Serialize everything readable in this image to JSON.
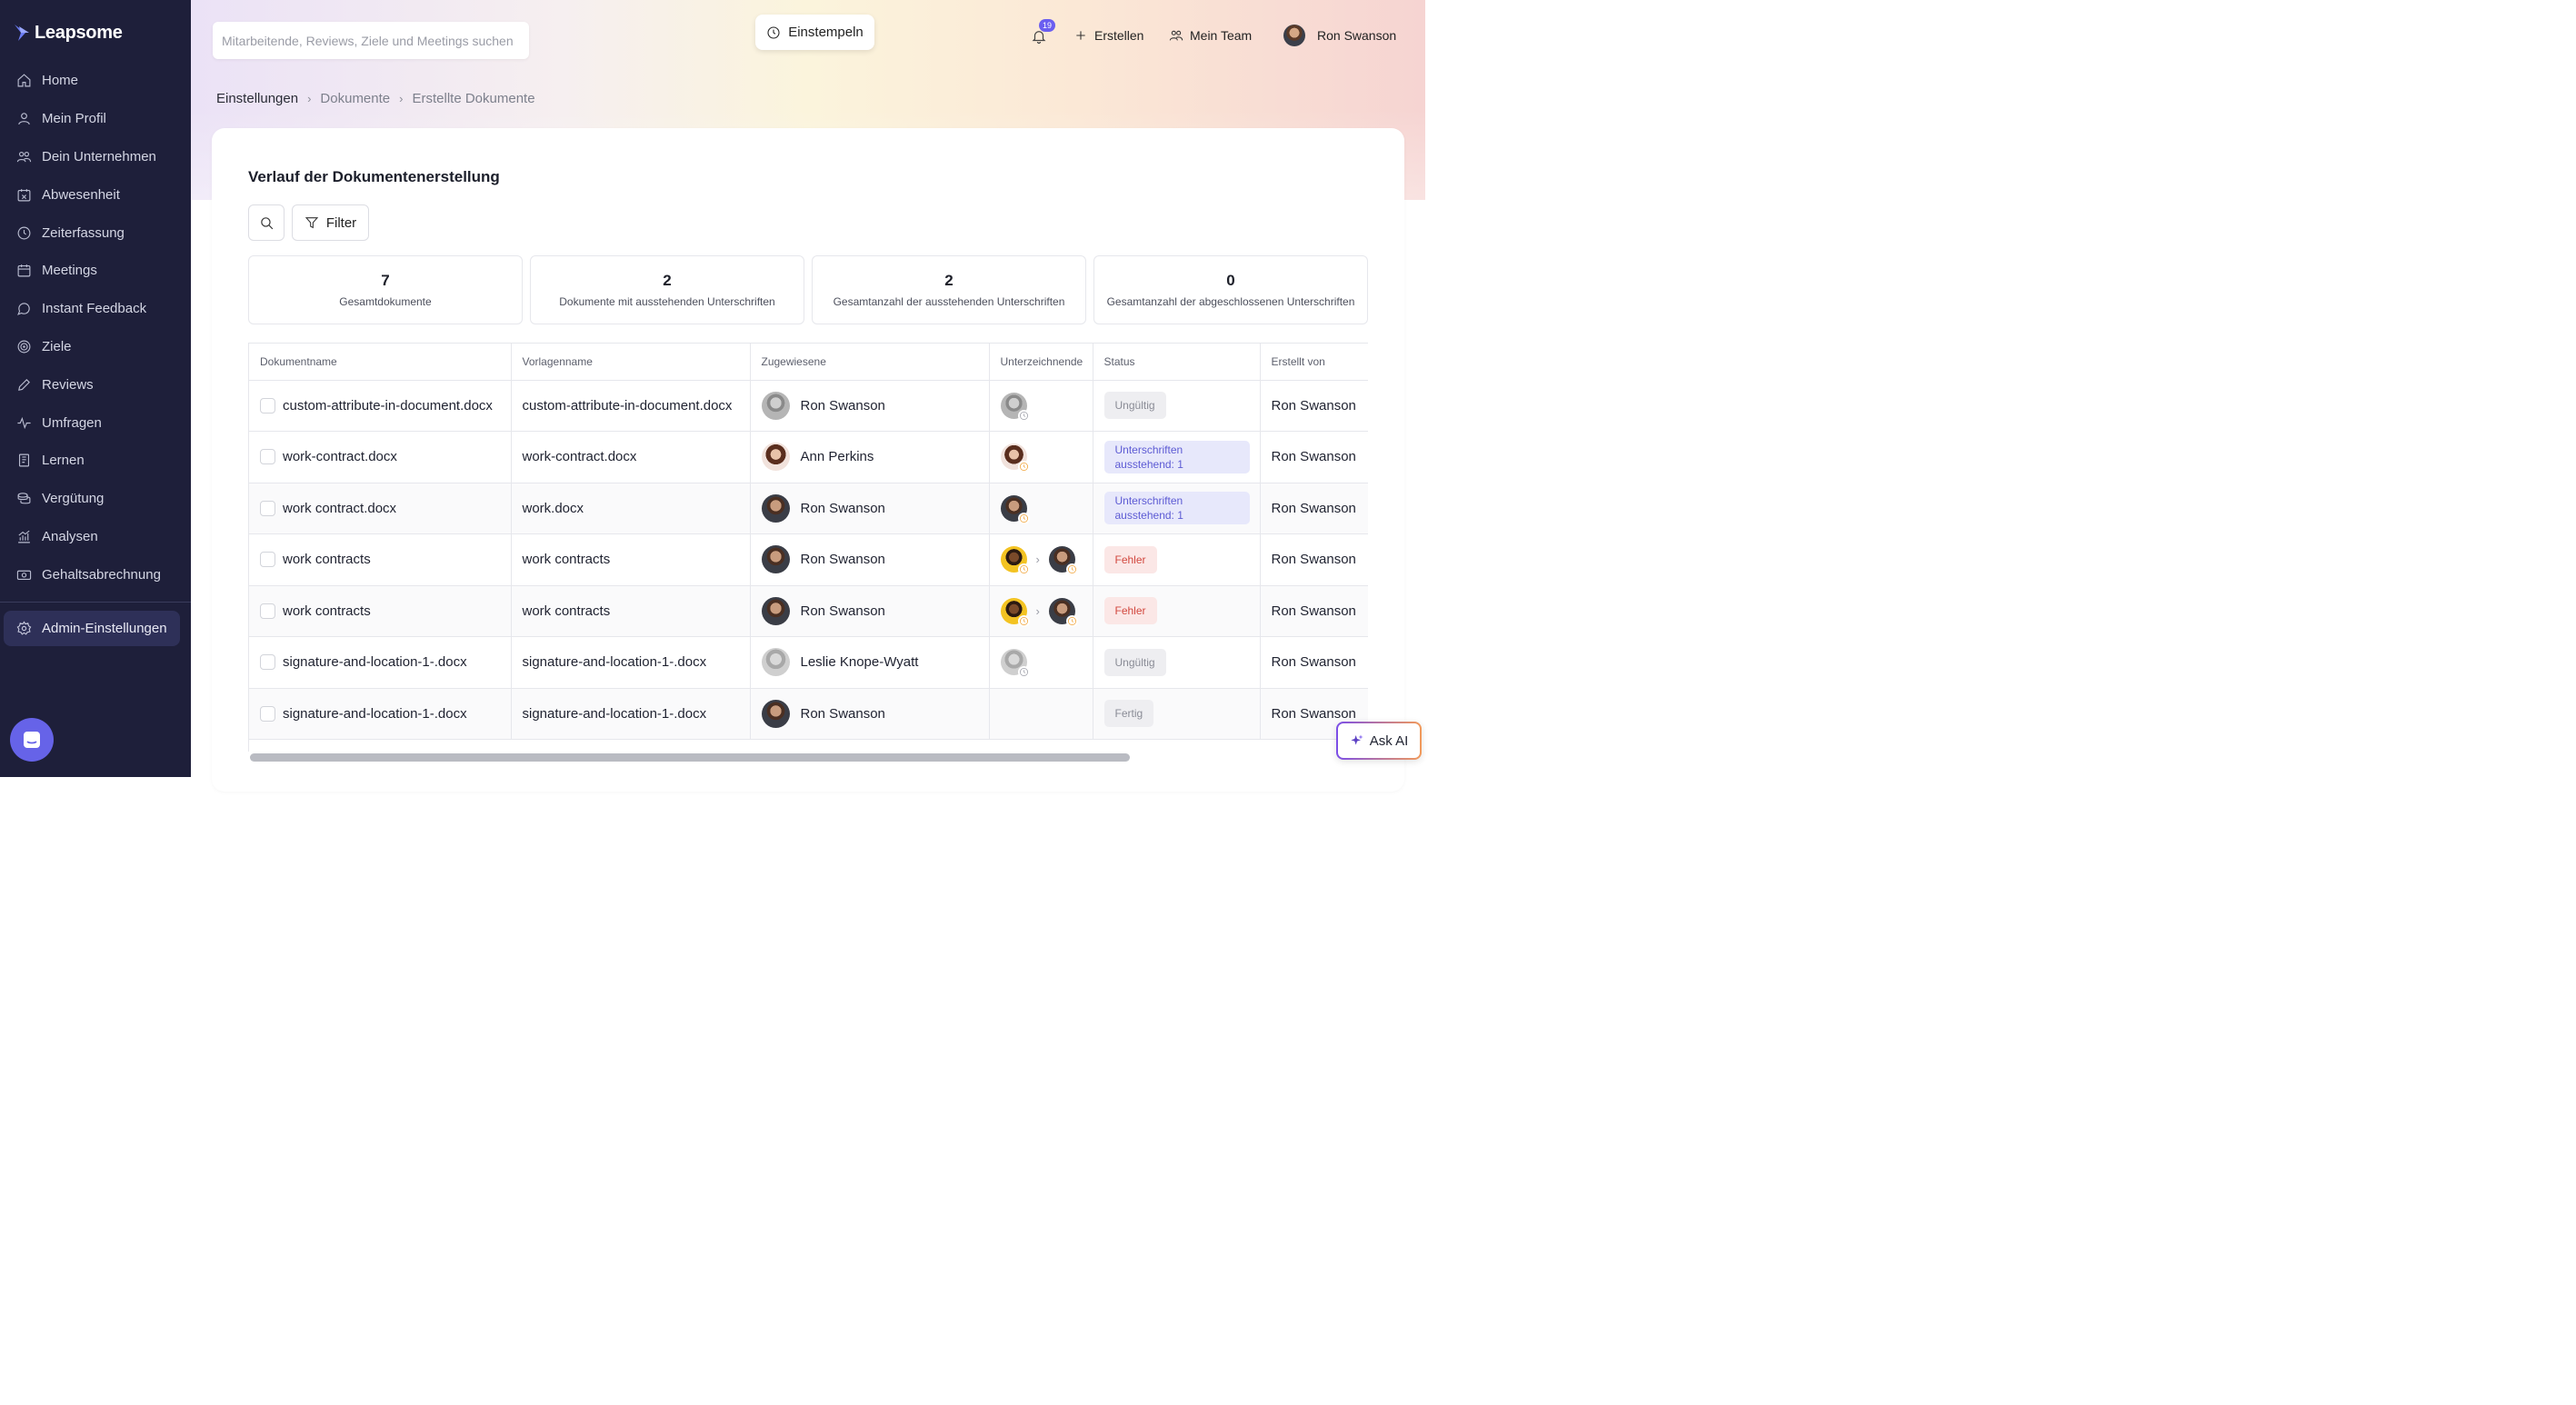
{
  "app": {
    "name": "Leapsome"
  },
  "sidebar": {
    "items": [
      {
        "label": "Home",
        "icon": "home-icon"
      },
      {
        "label": "Mein Profil",
        "icon": "user-icon"
      },
      {
        "label": "Dein Unternehmen",
        "icon": "users-icon"
      },
      {
        "label": "Abwesenheit",
        "icon": "calendar-x-icon"
      },
      {
        "label": "Zeiterfassung",
        "icon": "clock-icon"
      },
      {
        "label": "Meetings",
        "icon": "calendar-icon"
      },
      {
        "label": "Instant Feedback",
        "icon": "chat-icon"
      },
      {
        "label": "Ziele",
        "icon": "target-icon"
      },
      {
        "label": "Reviews",
        "icon": "pencil-icon"
      },
      {
        "label": "Umfragen",
        "icon": "pulse-icon"
      },
      {
        "label": "Lernen",
        "icon": "book-icon"
      },
      {
        "label": "Vergütung",
        "icon": "coins-icon"
      },
      {
        "label": "Analysen",
        "icon": "chart-icon"
      },
      {
        "label": "Gehaltsabrechnung",
        "icon": "money-icon"
      }
    ],
    "admin": {
      "label": "Admin-Einstellungen",
      "icon": "gear-icon"
    }
  },
  "header": {
    "search_placeholder": "Mitarbeitende, Reviews, Ziele und Meetings suchen",
    "clock_in": "Einstempeln",
    "notifications_count": "19",
    "create": "Erstellen",
    "my_team": "Mein Team",
    "user": "Ron Swanson"
  },
  "breadcrumb": [
    "Einstellungen",
    "Dokumente",
    "Erstellte Dokumente"
  ],
  "page": {
    "title": "Verlauf der Dokumentenerstellung",
    "filter": "Filter"
  },
  "stats": [
    {
      "value": "7",
      "label": "Gesamtdokumente"
    },
    {
      "value": "2",
      "label": "Dokumente mit ausstehenden Unterschriften"
    },
    {
      "value": "2",
      "label": "Gesamtanzahl der ausstehenden Unterschriften"
    },
    {
      "value": "0",
      "label": "Gesamtanzahl der abgeschlossenen Unterschriften"
    }
  ],
  "table": {
    "columns": [
      "Dokumentname",
      "Vorlagenname",
      "Zugewiesene",
      "Unterzeichnende",
      "Status",
      "Erstellt von"
    ],
    "rows": [
      {
        "doc": "custom-attribute-in-document.docx",
        "template": "custom-attribute-in-document.docx",
        "assignee": "Ron Swanson",
        "status": "Ungültig",
        "creator": "Ron Swanson"
      },
      {
        "doc": "work-contract.docx",
        "template": "work-contract.docx",
        "assignee": "Ann Perkins",
        "status": "Unterschriften ausstehend: 1",
        "creator": "Ron Swanson"
      },
      {
        "doc": "work contract.docx",
        "template": "work.docx",
        "assignee": "Ron Swanson",
        "status": "Unterschriften ausstehend: 1",
        "creator": "Ron Swanson"
      },
      {
        "doc": "work contracts",
        "template": "work contracts",
        "assignee": "Ron Swanson",
        "status": "Fehler",
        "creator": "Ron Swanson"
      },
      {
        "doc": "work contracts",
        "template": "work contracts",
        "assignee": "Ron Swanson",
        "status": "Fehler",
        "creator": "Ron Swanson"
      },
      {
        "doc": "signature-and-location-1-.docx",
        "template": "signature-and-location-1-.docx",
        "assignee": "Leslie Knope-Wyatt",
        "status": "Ungültig",
        "creator": "Ron Swanson"
      },
      {
        "doc": "signature-and-location-1-.docx",
        "template": "signature-and-location-1-.docx",
        "assignee": "Ron Swanson",
        "status": "Fertig",
        "creator": "Ron Swanson"
      }
    ]
  },
  "ask_ai": "Ask AI",
  "colors": {
    "sidebar_bg": "#1e1f3a",
    "accent": "#6663e8",
    "error": "#d2483f",
    "pending": "#5d5bd4"
  }
}
